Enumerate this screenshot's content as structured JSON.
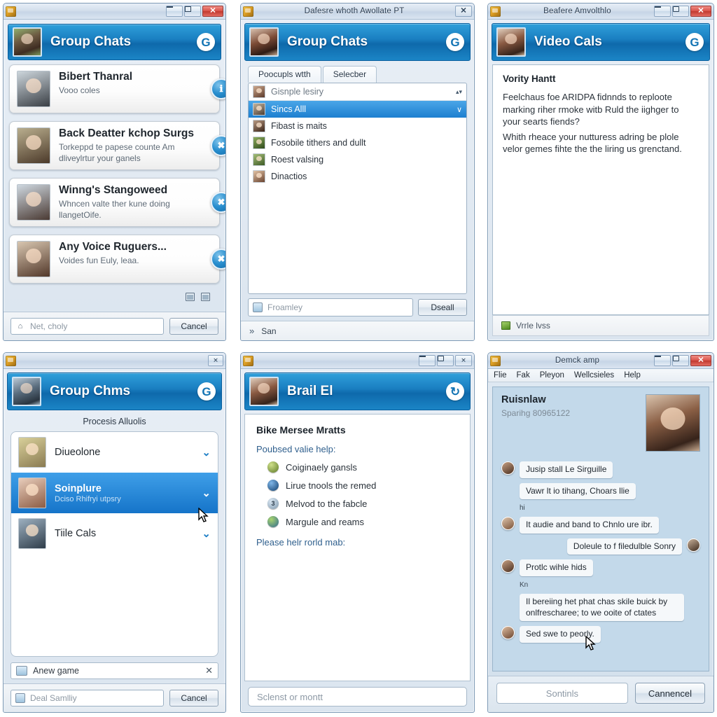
{
  "panels": {
    "p1": {
      "titlebar": {
        "title": "",
        "icon": "app-icon",
        "minimize": "–",
        "maximize": "□",
        "close": "✕"
      },
      "header": {
        "title": "Group Chats",
        "refresh_glyph": "G",
        "avatar": "user-avatar"
      },
      "cards": [
        {
          "title": "Bibert Thanral",
          "sub": "Vooo coles",
          "badge": "ℹ"
        },
        {
          "title": "Back Deatter kchop Surgs",
          "sub": "Torkeppd te papese counte Am dliveylrtur your ganels",
          "badge": "✖"
        },
        {
          "title": "Winng's Stangoweed",
          "sub": "Whncen valte ther kune doing llangetOife.",
          "badge": "✖"
        },
        {
          "title": "Any Voice Ruguers...",
          "sub": "Voides fun Euly, leaa.",
          "badge": "✖"
        }
      ],
      "footer": {
        "placeholder": "Net, choly",
        "button": "Cancel"
      }
    },
    "p2": {
      "titlebar": {
        "title": "Dafesre whoth Awollate PT",
        "close": "✕"
      },
      "header": {
        "title": "Group Chats",
        "refresh_glyph": "G"
      },
      "tabs": [
        {
          "label": "Poocupls wtth"
        },
        {
          "label": "Selecber"
        }
      ],
      "combo": {
        "value": "Gisnple lesiry",
        "spinner": "▴▾"
      },
      "rows": [
        {
          "label": "Sincs Alll",
          "selected": true,
          "chev": "∨"
        },
        {
          "label": "Fibast is maits",
          "selected": false,
          "chev": ""
        },
        {
          "label": "Fosobile tithers and dullt",
          "selected": false,
          "chev": ""
        },
        {
          "label": "Roest valsing",
          "selected": false,
          "chev": ""
        },
        {
          "label": "Dinactios",
          "selected": false,
          "chev": ""
        }
      ],
      "input": {
        "placeholder": "Froamley",
        "button": "Dseall"
      },
      "status": {
        "text": "San",
        "icon": "»"
      }
    },
    "p3": {
      "titlebar": {
        "title": "Beafere Amvolthlo",
        "minimize": "–",
        "restore": "❐",
        "close": "✕"
      },
      "header": {
        "title": "Video Cals",
        "refresh_glyph": "G"
      },
      "doc": {
        "heading": "Vority Hantt",
        "paragraphs": [
          "Feelchaus foe ARIDPA fidnnds to reploote marking riher rmoke witb Ruld the iighger to your searts fiends?",
          "Whith rheace your nutturess adring be plole velor gemes fihte the the liring us grenctand."
        ]
      },
      "status": {
        "text": "Vrrle  lvss",
        "icon": "green-icon"
      }
    },
    "p4": {
      "titlebar": {
        "title": "",
        "close": "✕"
      },
      "header": {
        "title": "Group Chms",
        "refresh_glyph": "G"
      },
      "subheading": "Procesis  Alluolis",
      "rows": [
        {
          "name": "Diueolone",
          "sub": "",
          "selected": false
        },
        {
          "name": "Soinplure",
          "sub": "Dciso Rhifryi utpsry",
          "selected": true
        },
        {
          "name": "Tiile Cals",
          "sub": "",
          "selected": false
        }
      ],
      "inline_input": {
        "text": "Anew game",
        "x": "✕"
      },
      "footer": {
        "placeholder": "Deal Samlliy",
        "button": "Cancel"
      }
    },
    "p5": {
      "titlebar": {
        "title": "",
        "minimize": "–",
        "maximize": "❐",
        "close": "✕"
      },
      "header": {
        "title": "Brail El",
        "refresh_glyph": "↻"
      },
      "doc": {
        "heading": "Bike Mersee Mratts",
        "label_top": "Poubsed valie help:",
        "items": [
          {
            "text": "Coiginaely gansls",
            "bullet": "c1",
            "num": ""
          },
          {
            "text": "Lirue tnools the remed",
            "bullet": "c2",
            "num": ""
          },
          {
            "text": "Melvod to the fabcle",
            "bullet": "c3",
            "num": "3"
          },
          {
            "text": "Margule and reams",
            "bullet": "c4",
            "num": ""
          }
        ],
        "label_bottom": "Please helr rorld mab:"
      },
      "footer": {
        "placeholder": "Sclenst or montt"
      }
    },
    "p6": {
      "titlebar": {
        "title": "Demck amp",
        "minimize": "–",
        "restore": "❐",
        "close": "✕"
      },
      "menus": [
        "Flie",
        "Fak",
        "Pleyon",
        "Wellcsieles",
        "Help"
      ],
      "contact": {
        "name": "Ruisnlaw",
        "sub": "Sparihg 80965122"
      },
      "messages": [
        {
          "side": "left",
          "text": "Jusip stall Le Sirguille",
          "avatar": "p1"
        },
        {
          "side": "left",
          "text": "Vawr lt io tihang, Choars llie",
          "avatar": "",
          "note": "hi"
        },
        {
          "side": "left",
          "text": "It audie and band to Chnlo ure ibr.",
          "avatar": "p2"
        },
        {
          "side": "right",
          "text": "Doleule to f filedulble Sonry",
          "avatar": "p3"
        },
        {
          "side": "left",
          "text": "Protlc wihle hids",
          "avatar": "p1",
          "note": "Kn"
        },
        {
          "side": "left",
          "text": "Il bereiing het phat chas skile buick by onlfrescharee; to we ooite of ctates",
          "avatar": ""
        },
        {
          "side": "left",
          "text": "Sed swe to peorly.",
          "avatar": "p4"
        }
      ],
      "footer": {
        "input_placeholder": "Sontinls",
        "button": "Cannencel"
      }
    }
  }
}
